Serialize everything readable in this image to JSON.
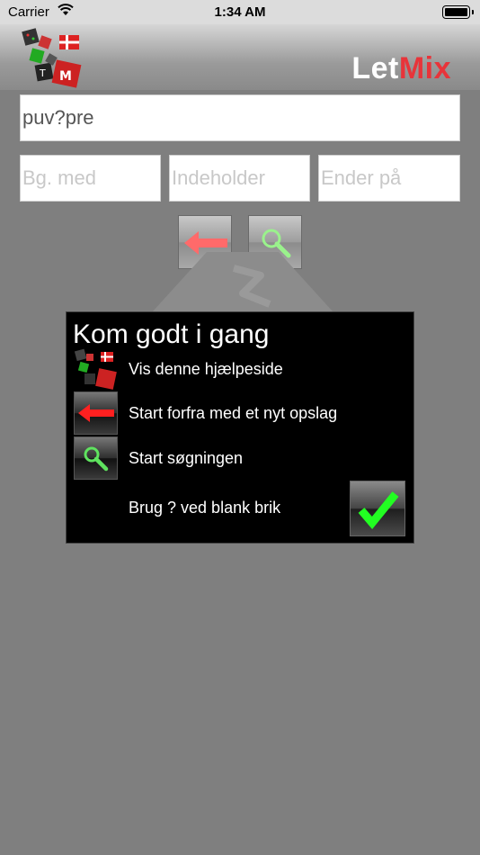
{
  "status_bar": {
    "carrier": "Carrier",
    "time": "1:34 AM"
  },
  "header": {
    "brand_let": "Let",
    "brand_mix": "Mix",
    "brand_colors": {
      "let": "#ffffff",
      "mix": "#e8343a"
    }
  },
  "search": {
    "pattern_value": "puv?pre",
    "begins_placeholder": "Bg. med",
    "contains_placeholder": "Indeholder",
    "ends_placeholder": "Ender på"
  },
  "toolbar": {
    "back_icon": "red-left-arrow-icon",
    "search_icon": "green-magnifier-icon"
  },
  "help": {
    "title": "Kom godt i gang",
    "rows": [
      {
        "icon": "letmix-logo-icon",
        "text": "Vis denne hjælpeside"
      },
      {
        "icon": "red-left-arrow-icon",
        "text": "Start forfra med et nyt opslag"
      },
      {
        "icon": "green-magnifier-icon",
        "text": "Start søgningen"
      },
      {
        "icon": "",
        "text": "Brug ? ved blank brik"
      }
    ],
    "ok_icon": "green-checkmark-icon"
  }
}
